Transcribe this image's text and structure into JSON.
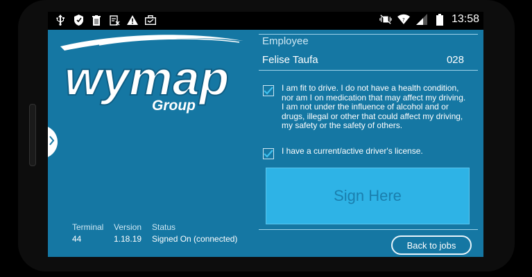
{
  "status_bar": {
    "time": "13:58",
    "left_icons": [
      "usb-icon",
      "shield-icon",
      "trash-icon",
      "clipboard-icon",
      "warning-icon",
      "briefcase-icon"
    ],
    "right_icons": [
      "vibrate-mute-icon",
      "wifi-icon",
      "signal-icon",
      "battery-icon"
    ]
  },
  "logo": {
    "brand": "wymap",
    "subtitle": "Group"
  },
  "employee": {
    "label": "Employee",
    "name": "Felise Taufa",
    "number": "028"
  },
  "declarations": [
    {
      "text": "I am fit to drive. I do not have a health condition, nor am I on medication that may affect my driving. I am not under the influence of alcohol and or drugs, illegal or other that could affect my driving, my safety or the safety of others.",
      "checked": true
    },
    {
      "text": "I have a current/active driver's license.",
      "checked": true
    }
  ],
  "signature": {
    "placeholder": "Sign Here"
  },
  "actions": {
    "back_label": "Back to jobs"
  },
  "footer": {
    "terminal_label": "Terminal",
    "terminal_value": "44",
    "version_label": "Version",
    "version_value": "1.18.19",
    "status_label": "Status",
    "status_value": "Signed On (connected)"
  },
  "colors": {
    "background": "#1577a3",
    "sign_box": "#2eb3e6",
    "accent_text": "#1a7fae"
  }
}
